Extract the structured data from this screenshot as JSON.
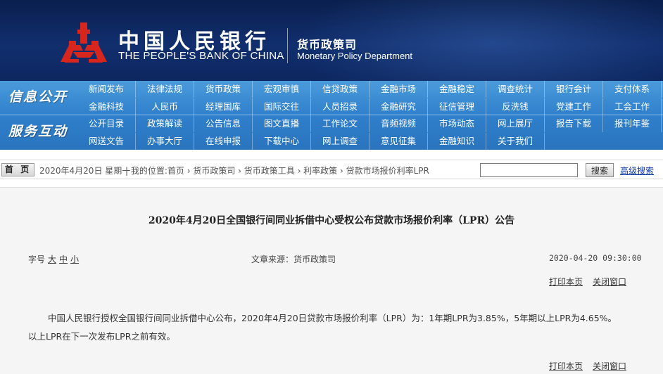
{
  "header": {
    "bank_name_cn": "中国人民银行",
    "bank_name_en": "THE PEOPLE'S BANK OF CHINA",
    "dept_name_cn": "货币政策司",
    "dept_name_en": "Monetary Policy Department"
  },
  "nav": {
    "info_label": "信息公开",
    "service_label": "服务互动",
    "row1": [
      "新闻发布",
      "法律法规",
      "货币政策",
      "宏观审慎",
      "信贷政策",
      "金融市场",
      "金融稳定",
      "调查统计",
      "银行会计",
      "支付体系"
    ],
    "row2": [
      "金融科技",
      "人民币",
      "经理国库",
      "国际交往",
      "人员招录",
      "金融研究",
      "征信管理",
      "反洗钱",
      "党建工作",
      "工会工作"
    ],
    "row3": [
      "公开目录",
      "政策解读",
      "公告信息",
      "图文直播",
      "工作论文",
      "音频视频",
      "市场动态",
      "网上展厅",
      "报告下载",
      "报刊年鉴"
    ],
    "row4": [
      "网送文告",
      "办事大厅",
      "在线申报",
      "下载中心",
      "网上调查",
      "意见征集",
      "金融知识",
      "关于我们"
    ]
  },
  "toolbar": {
    "home_label": "首 页",
    "date_text": "2020年4月20日 星期一",
    "breadcrumb": "| 我的位置:首页 › 货币政策司 › 货币政策工具 › 利率政策 › 贷款市场报价利率LPR",
    "search_value": "",
    "search_button": "搜索",
    "advanced_search": "高级搜索"
  },
  "article": {
    "title": "2020年4月20日全国银行间同业拆借中心受权公布贷款市场报价利率（LPR）公告",
    "font_size_label": "字号",
    "font_large": "大",
    "font_medium": "中",
    "font_small": "小",
    "source": "文章来源：货币政策司",
    "publish_time": "2020-04-20 09:30:00",
    "print_label": "打印本页",
    "close_label": "关闭窗口",
    "body": "中国人民银行授权全国银行间同业拆借中心公布，2020年4月20日贷款市场报价利率（LPR）为：1年期LPR为3.85%，5年期以上LPR为4.65%。以上LPR在下一次发布LPR之前有效。"
  },
  "colors": {
    "banner_bg": "#112e6e",
    "nav_bg": "#2f7fcc",
    "logo_red": "#d7261e",
    "link_blue": "#0b36a8",
    "content_bg": "#f5f5f5"
  }
}
